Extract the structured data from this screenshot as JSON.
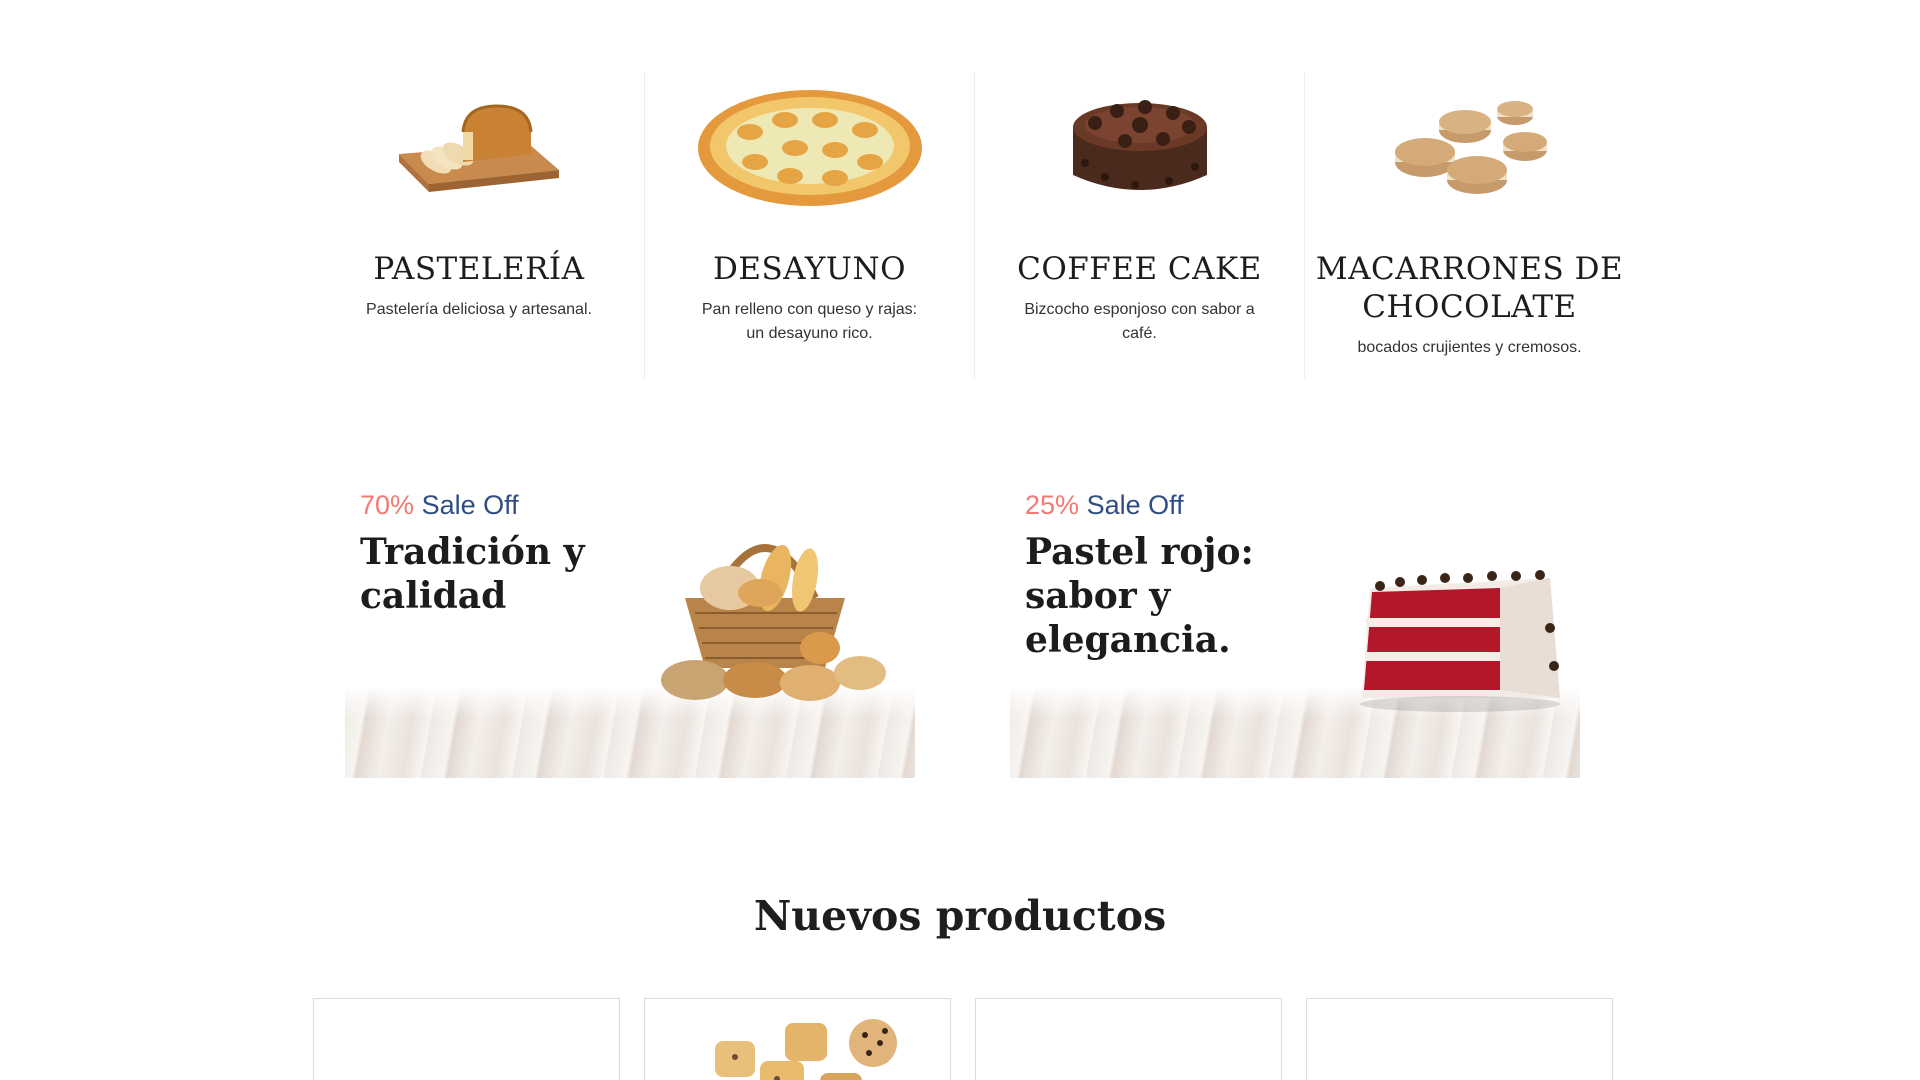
{
  "categories": [
    {
      "title": "PASTELERÍA",
      "description": "Pastelería deliciosa y artesanal.",
      "image": "bread-loaf-image"
    },
    {
      "title": "DESAYUNO",
      "description": "Pan relleno con queso y rajas: un desayuno rico.",
      "image": "filled-bread-image"
    },
    {
      "title": "COFFEE CAKE",
      "description": "Bizcocho esponjoso con sabor a café.",
      "image": "chocolate-cake-image"
    },
    {
      "title": "MACARRONES DE CHOCOLATE",
      "description": "bocados crujientes y cremosos.",
      "image": "macarons-image"
    }
  ],
  "banners": [
    {
      "percent": "70%",
      "sale_label": "Sale Off",
      "title": "Tradición y calidad",
      "image": "bread-basket-image"
    },
    {
      "percent": "25%",
      "sale_label": "Sale Off",
      "title": "Pastel rojo: sabor y elegancia.",
      "image": "red-velvet-cake-image"
    }
  ],
  "new_products": {
    "title": "Nuevos productos"
  },
  "colors": {
    "sale_percent": "#f27a73",
    "sale_label": "#2f4e84",
    "heading": "#1d1d1d",
    "card_border": "#dcdcdc"
  }
}
